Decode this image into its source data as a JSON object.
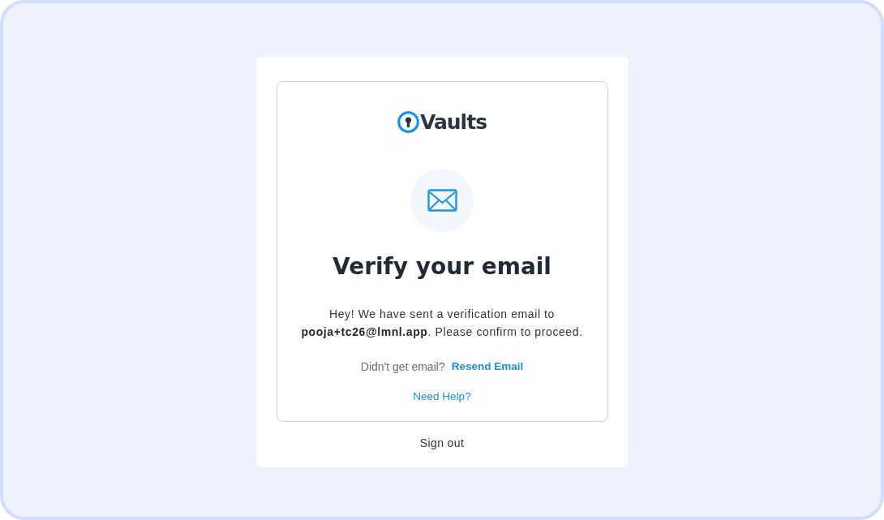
{
  "logo": {
    "text": "Vaults"
  },
  "heading": "Verify your email",
  "message": "Hey! We have sent a verification email to **pooja+tc26@lmnl.app**. Please confirm to proceed.",
  "resend": {
    "prompt": "Didn't get email?",
    "link": "Resend Email"
  },
  "help_link": "Need Help?",
  "sign_out": "Sign out"
}
